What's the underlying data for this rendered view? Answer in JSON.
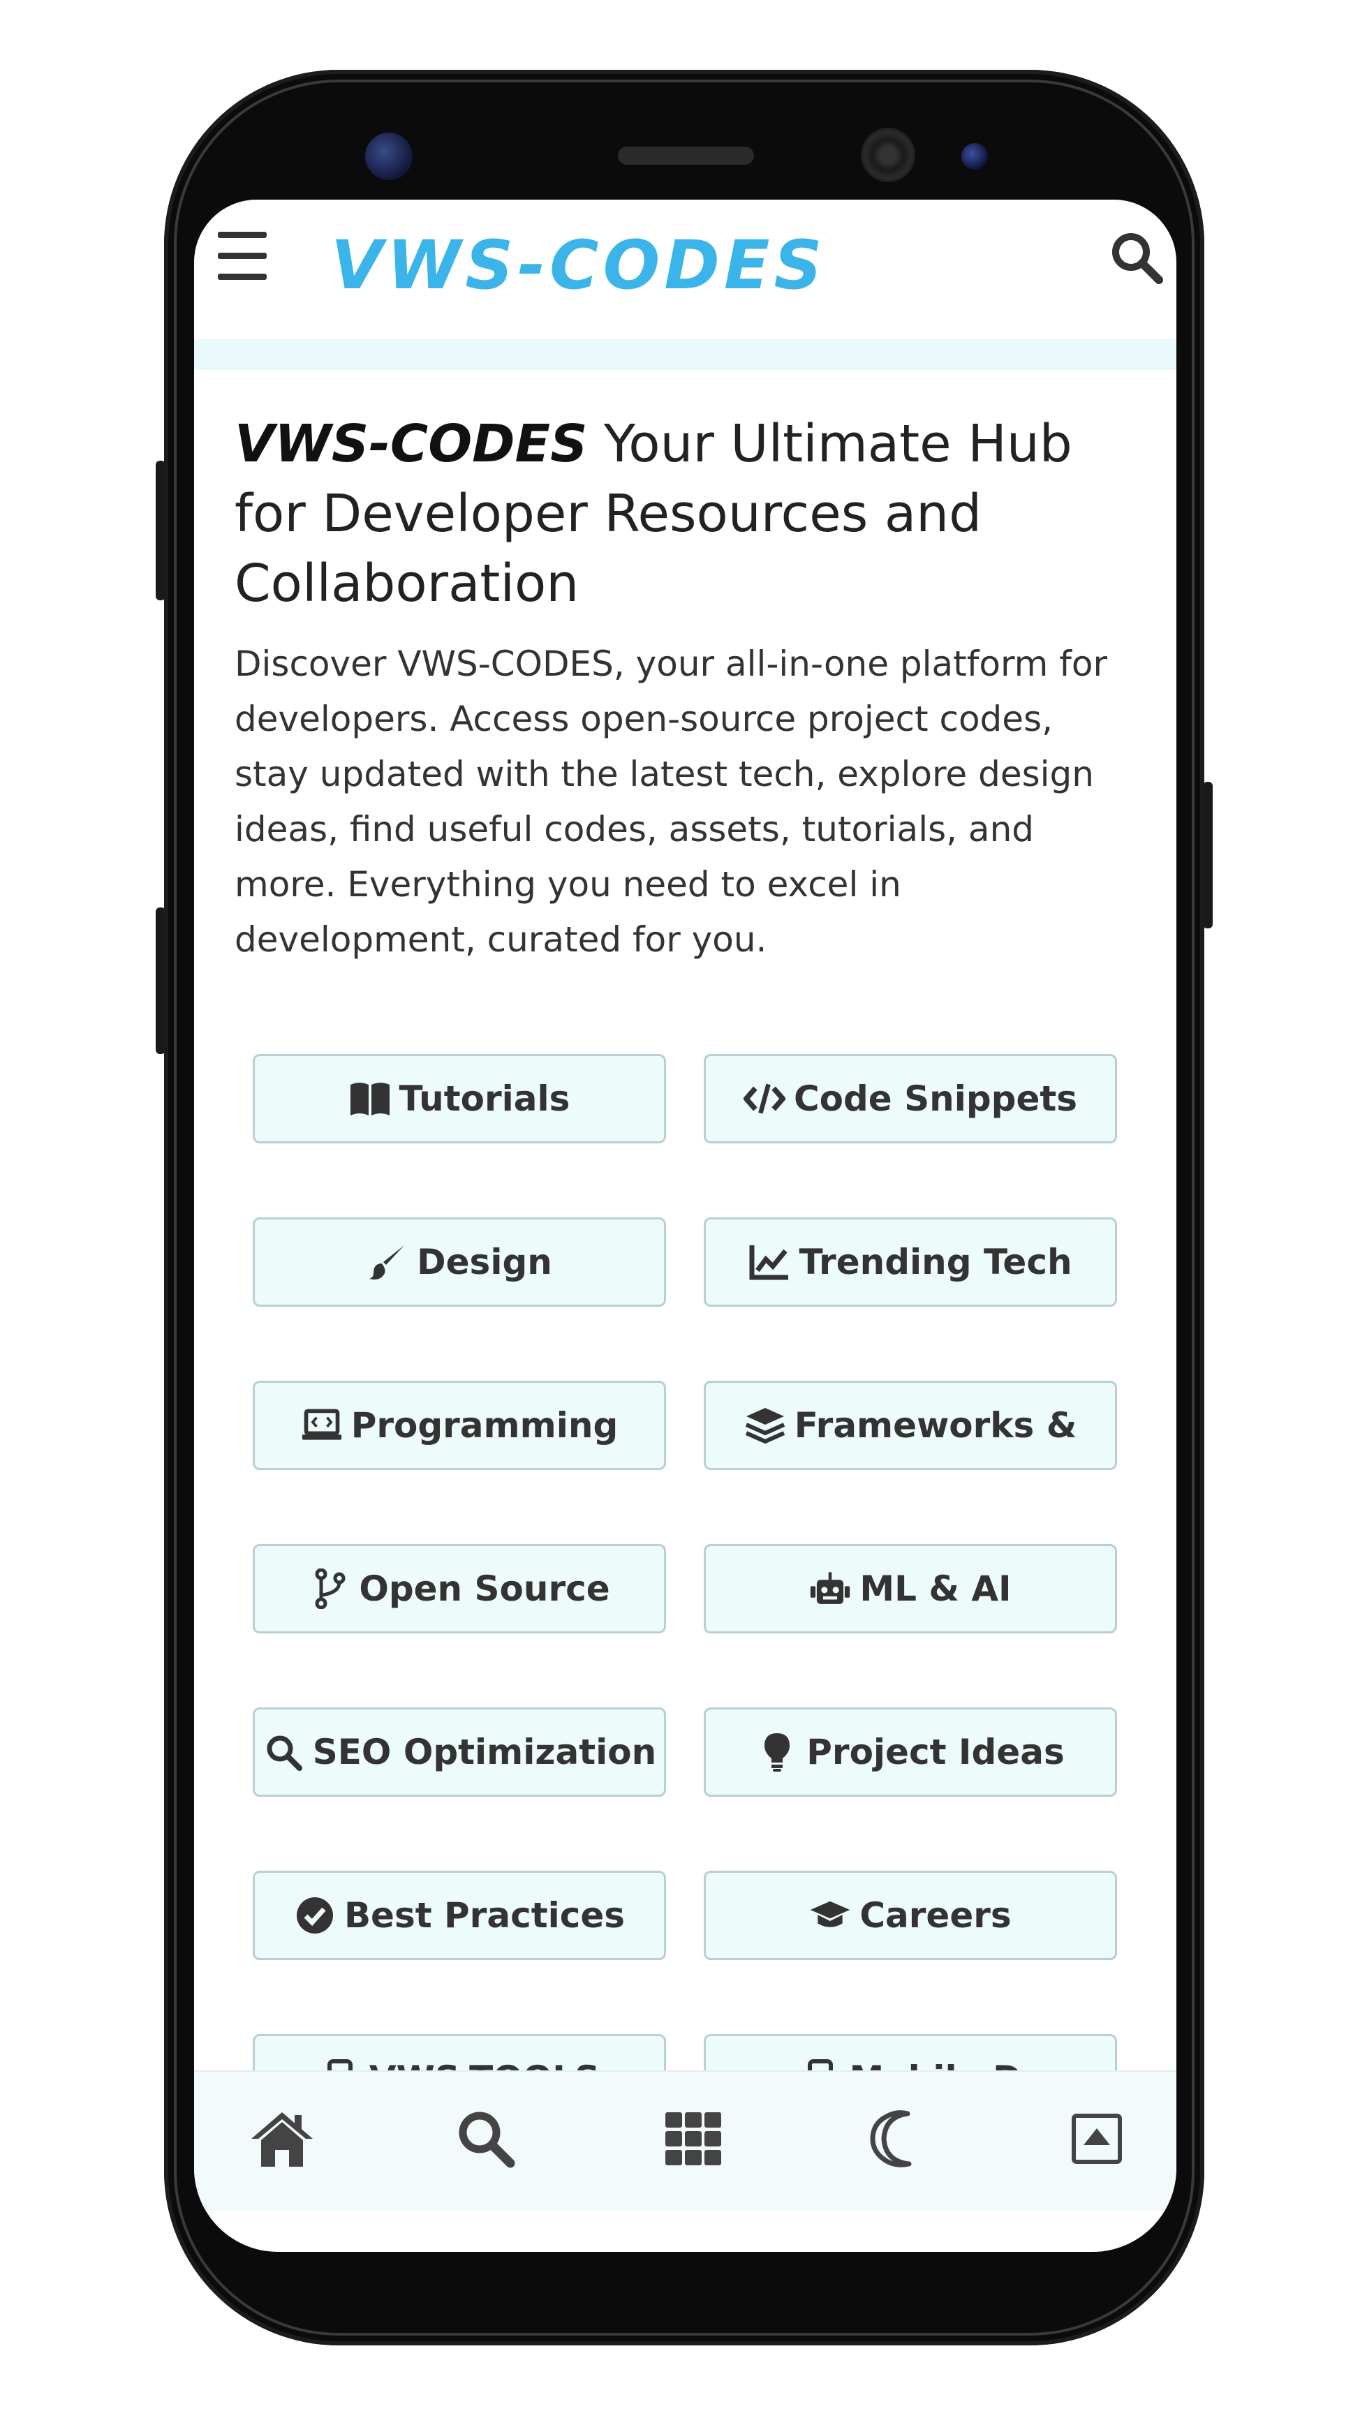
{
  "header": {
    "logo": "VWS-CODES"
  },
  "hero": {
    "brand": "VWS-CODES",
    "title_rest": " Your Ultimate Hub for Developer Resources and Collaboration",
    "description": "Discover VWS-CODES, your all-in-one platform for developers. Access open-source project codes, stay updated with the latest tech, explore design ideas, find useful codes, assets, tutorials, and more. Everything you need to excel in development, curated for you."
  },
  "categories": [
    {
      "label": "Tutorials",
      "icon": "book-open-icon"
    },
    {
      "label": "Code Snippets",
      "icon": "code-icon"
    },
    {
      "label": "Design",
      "icon": "paint-brush-icon"
    },
    {
      "label": "Trending Tech",
      "icon": "chart-line-icon"
    },
    {
      "label": "Programming",
      "icon": "laptop-code-icon"
    },
    {
      "label": "Frameworks &",
      "icon": "layer-group-icon"
    },
    {
      "label": "Open Source",
      "icon": "code-branch-icon"
    },
    {
      "label": "ML & AI",
      "icon": "robot-icon"
    },
    {
      "label": "SEO Optimization",
      "icon": "search-icon"
    },
    {
      "label": "Project Ideas",
      "icon": "lightbulb-icon"
    },
    {
      "label": "Best Practices",
      "icon": "check-circle-icon"
    },
    {
      "label": "Careers",
      "icon": "graduation-cap-icon"
    },
    {
      "label": "VWS-TOOLS",
      "icon": "mobile-icon"
    },
    {
      "label": "Mobile D",
      "icon": "mobile-icon"
    }
  ],
  "bottom_nav": [
    {
      "name": "home",
      "icon": "home-icon"
    },
    {
      "name": "search",
      "icon": "search-icon"
    },
    {
      "name": "apps",
      "icon": "grid-icon"
    },
    {
      "name": "theme",
      "icon": "moon-icon"
    },
    {
      "name": "scroll-top",
      "icon": "caret-up-square-icon"
    }
  ],
  "colors": {
    "brand": "#3bb4ea",
    "button_bg": "#edfbfb",
    "button_border": "#b9cfd3",
    "nav_bg": "#f3fafc"
  }
}
